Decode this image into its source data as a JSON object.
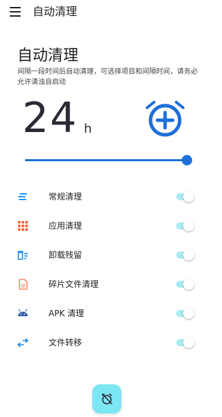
{
  "appbar": {
    "title": "自动清理",
    "menu_icon": "menu-icon"
  },
  "header": {
    "title": "自动清理",
    "description": "间隔一段时间后自动清理，可选择项目和间隔时间，请务必允许清浊自启动"
  },
  "interval": {
    "value": "24",
    "unit": "h",
    "slider_fraction": 1.0,
    "icon": "alarm-add-icon"
  },
  "options": [
    {
      "label": "常规清理",
      "icon": "lines-icon",
      "icon_color": "#2196f3",
      "enabled": true
    },
    {
      "label": "应用清理",
      "icon": "apps-grid-icon",
      "icon_color": "#ff5722",
      "enabled": true
    },
    {
      "label": "卸载残留",
      "icon": "uninstall-residue-icon",
      "icon_color": "#1e88e5",
      "enabled": true
    },
    {
      "label": "碎片文件清理",
      "icon": "document-icon",
      "icon_color": "#ff8a65",
      "enabled": true
    },
    {
      "label": "APK 清理",
      "icon": "android-icon",
      "icon_color": "#2f5fa8",
      "enabled": true
    },
    {
      "label": "文件转移",
      "icon": "transfer-arrows-icon",
      "icon_color": "#1e88e5",
      "enabled": true
    }
  ],
  "fab": {
    "icon": "alarm-off-icon"
  },
  "colors": {
    "accent": "#1e6fd9",
    "toggle_on": "#a8ebf2",
    "fab": "#7de6f3"
  }
}
